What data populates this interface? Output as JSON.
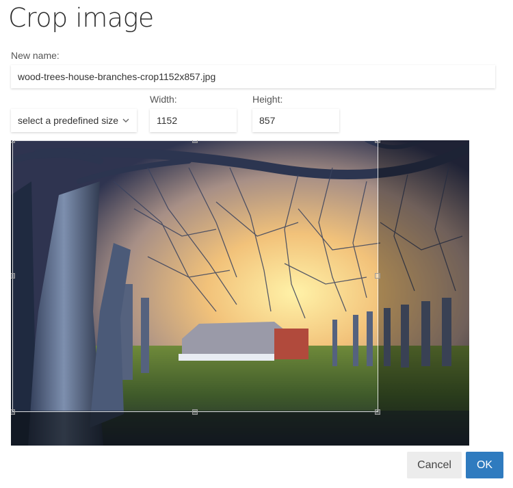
{
  "dialog": {
    "title": "Crop image",
    "new_name_label": "New name:",
    "new_name_value": "wood-trees-house-branches-crop1152x857.jpg",
    "predefined_size_label": "select a predefined size",
    "width_label": "Width:",
    "width_value": "1152",
    "height_label": "Height:",
    "height_value": "857",
    "cancel_label": "Cancel",
    "ok_label": "OK"
  },
  "colors": {
    "ok_button": "#2f7bbf",
    "cancel_button": "#ececec"
  },
  "icons": {
    "dropdown": "chevron-down-icon"
  }
}
